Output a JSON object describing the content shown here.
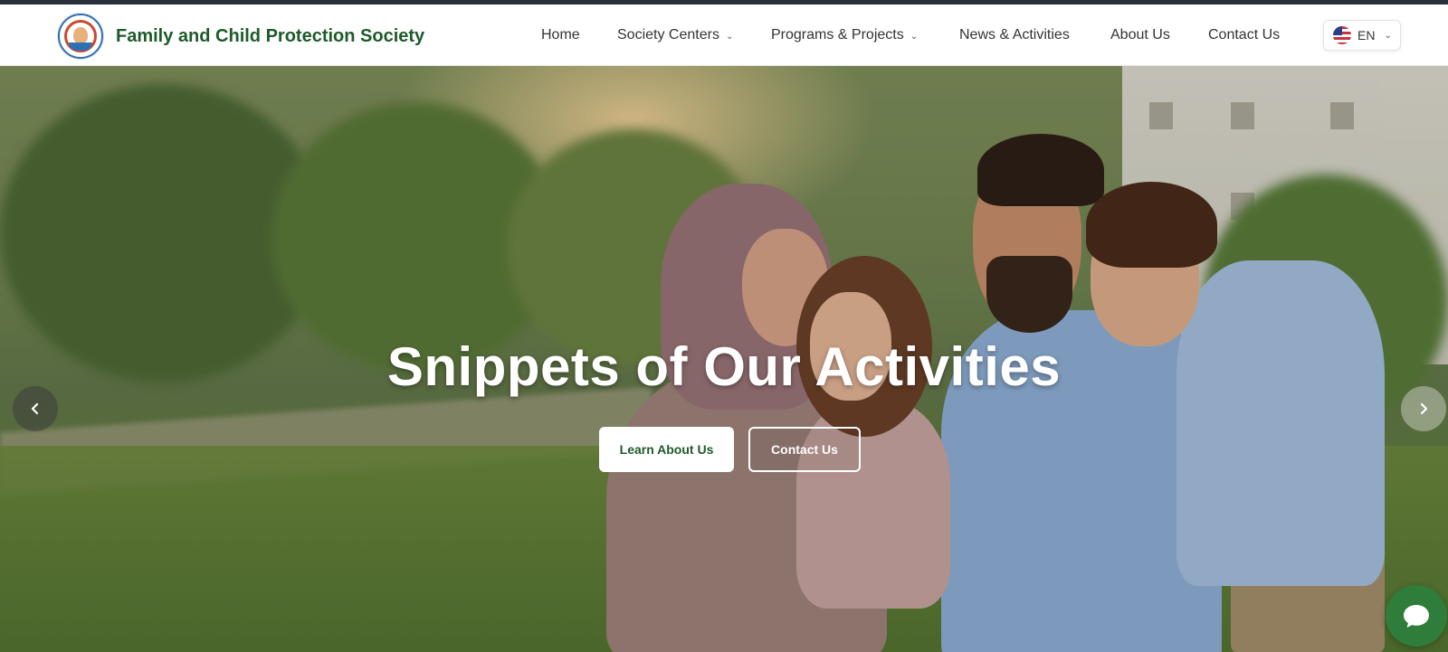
{
  "brand": {
    "name": "Family and Child Protection Society",
    "logo_icon": "society-logo-icon"
  },
  "nav": {
    "items": [
      {
        "label": "Home",
        "has_dropdown": false
      },
      {
        "label": "Society Centers",
        "has_dropdown": true
      },
      {
        "label": "Programs & Projects",
        "has_dropdown": true
      },
      {
        "label": "News & Activities",
        "has_dropdown": false
      },
      {
        "label": "About Us",
        "has_dropdown": false
      },
      {
        "label": "Contact Us",
        "has_dropdown": false
      }
    ],
    "language": {
      "label": "EN",
      "flag_icon": "us-flag-icon"
    }
  },
  "hero": {
    "title": "Snippets of Our Activities",
    "primary_button": "Learn About Us",
    "secondary_button": "Contact Us",
    "prev_icon": "chevron-left-icon",
    "next_icon": "chevron-right-icon"
  },
  "chat": {
    "icon": "chat-bubble-icon"
  },
  "colors": {
    "brand_green": "#1e5a2a",
    "chat_green": "#2f7d3a",
    "topbar": "#2a2e3a",
    "nav_text": "#333333"
  }
}
